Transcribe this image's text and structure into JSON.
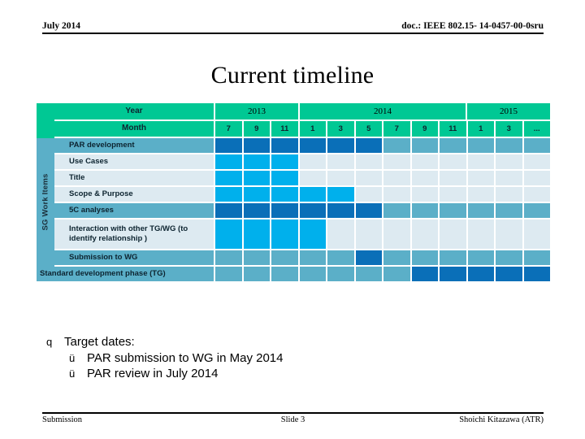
{
  "header": {
    "date": "July 2014",
    "doc": "doc.: IEEE 802.15- 14-0457-00-0sru"
  },
  "title": "Current timeline",
  "timeline": {
    "side_label": "SG Work Items",
    "year_label": "Year",
    "month_label": "Month",
    "year_groups": [
      {
        "label": "2013",
        "span": 3
      },
      {
        "label": "2014",
        "span": 6
      },
      {
        "label": "2015",
        "span": 3
      }
    ],
    "months": [
      "7",
      "9",
      "11",
      "1",
      "3",
      "5",
      "7",
      "9",
      "11",
      "1",
      "3",
      "..."
    ],
    "colors": {
      "header_green": "#00C894",
      "fill_dark": "#0A6FB8",
      "fill_light": "#00B0EC",
      "empty_dark": "#5BAFC8",
      "empty_light": "#DDEAF1"
    },
    "rows": [
      {
        "label": "PAR development",
        "band": "dark",
        "cells": [
          "dark",
          "dark",
          "dark",
          "dark",
          "dark",
          "dark",
          "",
          "",
          "",
          "",
          "",
          ""
        ]
      },
      {
        "label": "Use Cases",
        "band": "light",
        "cells": [
          "light",
          "light",
          "light",
          "",
          "",
          "",
          "",
          "",
          "",
          "",
          "",
          ""
        ]
      },
      {
        "label": "Title",
        "band": "light",
        "cells": [
          "light",
          "light",
          "light",
          "",
          "",
          "",
          "",
          "",
          "",
          "",
          "",
          ""
        ]
      },
      {
        "label": "Scope & Purpose",
        "band": "light",
        "cells": [
          "light",
          "light",
          "light",
          "light",
          "light",
          "",
          "",
          "",
          "",
          "",
          "",
          ""
        ]
      },
      {
        "label": "5C analyses",
        "band": "dark",
        "cells": [
          "dark",
          "dark",
          "dark",
          "dark",
          "dark",
          "dark",
          "",
          "",
          "",
          "",
          "",
          ""
        ]
      },
      {
        "label": "Interaction with other TG/WG (to identify relationship )",
        "band": "light",
        "cells": [
          "light",
          "light",
          "light",
          "light",
          "",
          "",
          "",
          "",
          "",
          "",
          "",
          ""
        ]
      },
      {
        "label": "Submission to WG",
        "band": "dark",
        "cells": [
          "",
          "",
          "",
          "",
          "",
          "dark",
          "",
          "",
          "",
          "",
          "",
          ""
        ]
      }
    ],
    "final_row": {
      "label": "Standard development phase (TG)",
      "band": "dark",
      "cells": [
        "",
        "",
        "",
        "",
        "",
        "",
        "",
        "dark",
        "dark",
        "dark",
        "dark",
        "dark"
      ]
    }
  },
  "bullets": {
    "level1_marker": "q",
    "level2_marker": "ü",
    "items": [
      {
        "level": 1,
        "text": "Target dates:"
      },
      {
        "level": 2,
        "text": "PAR submission to  WG in May 2014"
      },
      {
        "level": 2,
        "text": "PAR review in July 2014"
      }
    ]
  },
  "footer": {
    "left": "Submission",
    "center": "Slide 3",
    "right": "Shoichi Kitazawa (ATR)"
  }
}
